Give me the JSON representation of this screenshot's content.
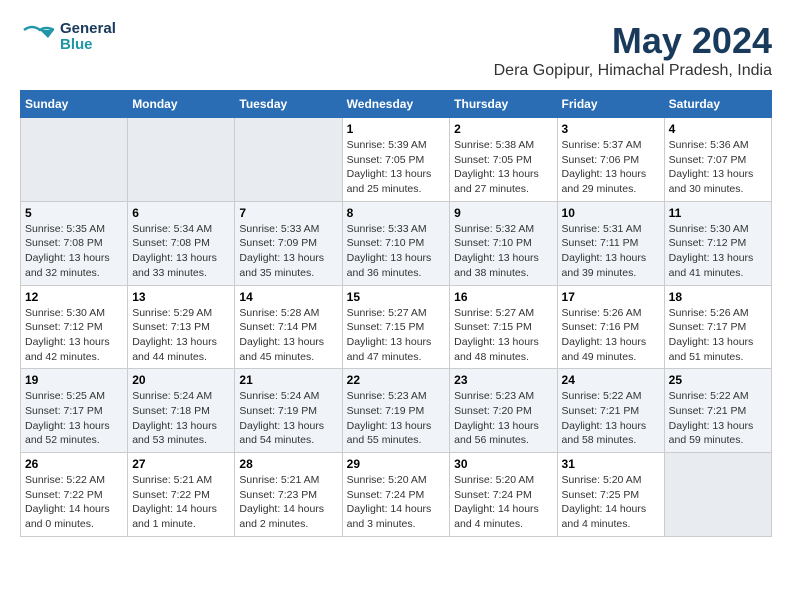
{
  "logo": {
    "line1": "General",
    "line2": "Blue"
  },
  "title": "May 2024",
  "location": "Dera Gopipur, Himachal Pradesh, India",
  "weekdays": [
    "Sunday",
    "Monday",
    "Tuesday",
    "Wednesday",
    "Thursday",
    "Friday",
    "Saturday"
  ],
  "weeks": [
    [
      {
        "day": "",
        "info": ""
      },
      {
        "day": "",
        "info": ""
      },
      {
        "day": "",
        "info": ""
      },
      {
        "day": "1",
        "info": "Sunrise: 5:39 AM\nSunset: 7:05 PM\nDaylight: 13 hours\nand 25 minutes."
      },
      {
        "day": "2",
        "info": "Sunrise: 5:38 AM\nSunset: 7:05 PM\nDaylight: 13 hours\nand 27 minutes."
      },
      {
        "day": "3",
        "info": "Sunrise: 5:37 AM\nSunset: 7:06 PM\nDaylight: 13 hours\nand 29 minutes."
      },
      {
        "day": "4",
        "info": "Sunrise: 5:36 AM\nSunset: 7:07 PM\nDaylight: 13 hours\nand 30 minutes."
      }
    ],
    [
      {
        "day": "5",
        "info": "Sunrise: 5:35 AM\nSunset: 7:08 PM\nDaylight: 13 hours\nand 32 minutes."
      },
      {
        "day": "6",
        "info": "Sunrise: 5:34 AM\nSunset: 7:08 PM\nDaylight: 13 hours\nand 33 minutes."
      },
      {
        "day": "7",
        "info": "Sunrise: 5:33 AM\nSunset: 7:09 PM\nDaylight: 13 hours\nand 35 minutes."
      },
      {
        "day": "8",
        "info": "Sunrise: 5:33 AM\nSunset: 7:10 PM\nDaylight: 13 hours\nand 36 minutes."
      },
      {
        "day": "9",
        "info": "Sunrise: 5:32 AM\nSunset: 7:10 PM\nDaylight: 13 hours\nand 38 minutes."
      },
      {
        "day": "10",
        "info": "Sunrise: 5:31 AM\nSunset: 7:11 PM\nDaylight: 13 hours\nand 39 minutes."
      },
      {
        "day": "11",
        "info": "Sunrise: 5:30 AM\nSunset: 7:12 PM\nDaylight: 13 hours\nand 41 minutes."
      }
    ],
    [
      {
        "day": "12",
        "info": "Sunrise: 5:30 AM\nSunset: 7:12 PM\nDaylight: 13 hours\nand 42 minutes."
      },
      {
        "day": "13",
        "info": "Sunrise: 5:29 AM\nSunset: 7:13 PM\nDaylight: 13 hours\nand 44 minutes."
      },
      {
        "day": "14",
        "info": "Sunrise: 5:28 AM\nSunset: 7:14 PM\nDaylight: 13 hours\nand 45 minutes."
      },
      {
        "day": "15",
        "info": "Sunrise: 5:27 AM\nSunset: 7:15 PM\nDaylight: 13 hours\nand 47 minutes."
      },
      {
        "day": "16",
        "info": "Sunrise: 5:27 AM\nSunset: 7:15 PM\nDaylight: 13 hours\nand 48 minutes."
      },
      {
        "day": "17",
        "info": "Sunrise: 5:26 AM\nSunset: 7:16 PM\nDaylight: 13 hours\nand 49 minutes."
      },
      {
        "day": "18",
        "info": "Sunrise: 5:26 AM\nSunset: 7:17 PM\nDaylight: 13 hours\nand 51 minutes."
      }
    ],
    [
      {
        "day": "19",
        "info": "Sunrise: 5:25 AM\nSunset: 7:17 PM\nDaylight: 13 hours\nand 52 minutes."
      },
      {
        "day": "20",
        "info": "Sunrise: 5:24 AM\nSunset: 7:18 PM\nDaylight: 13 hours\nand 53 minutes."
      },
      {
        "day": "21",
        "info": "Sunrise: 5:24 AM\nSunset: 7:19 PM\nDaylight: 13 hours\nand 54 minutes."
      },
      {
        "day": "22",
        "info": "Sunrise: 5:23 AM\nSunset: 7:19 PM\nDaylight: 13 hours\nand 55 minutes."
      },
      {
        "day": "23",
        "info": "Sunrise: 5:23 AM\nSunset: 7:20 PM\nDaylight: 13 hours\nand 56 minutes."
      },
      {
        "day": "24",
        "info": "Sunrise: 5:22 AM\nSunset: 7:21 PM\nDaylight: 13 hours\nand 58 minutes."
      },
      {
        "day": "25",
        "info": "Sunrise: 5:22 AM\nSunset: 7:21 PM\nDaylight: 13 hours\nand 59 minutes."
      }
    ],
    [
      {
        "day": "26",
        "info": "Sunrise: 5:22 AM\nSunset: 7:22 PM\nDaylight: 14 hours\nand 0 minutes."
      },
      {
        "day": "27",
        "info": "Sunrise: 5:21 AM\nSunset: 7:22 PM\nDaylight: 14 hours\nand 1 minute."
      },
      {
        "day": "28",
        "info": "Sunrise: 5:21 AM\nSunset: 7:23 PM\nDaylight: 14 hours\nand 2 minutes."
      },
      {
        "day": "29",
        "info": "Sunrise: 5:20 AM\nSunset: 7:24 PM\nDaylight: 14 hours\nand 3 minutes."
      },
      {
        "day": "30",
        "info": "Sunrise: 5:20 AM\nSunset: 7:24 PM\nDaylight: 14 hours\nand 4 minutes."
      },
      {
        "day": "31",
        "info": "Sunrise: 5:20 AM\nSunset: 7:25 PM\nDaylight: 14 hours\nand 4 minutes."
      },
      {
        "day": "",
        "info": ""
      }
    ]
  ]
}
